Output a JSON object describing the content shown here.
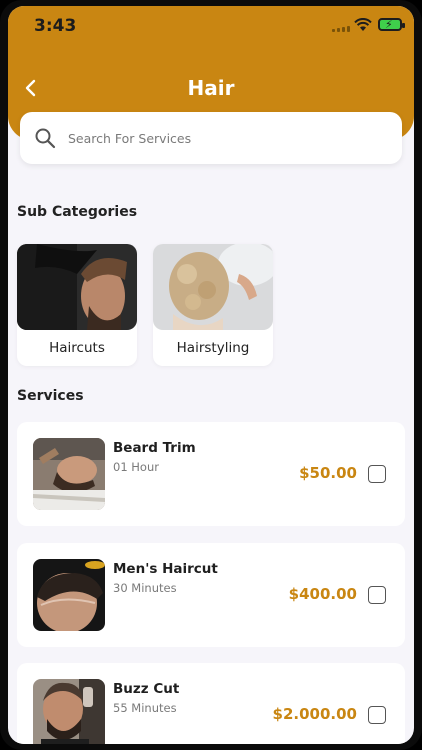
{
  "status_bar": {
    "time": "3:43"
  },
  "header": {
    "title": "Hair",
    "back_icon": "chevron-left-icon"
  },
  "search": {
    "placeholder": "Search For Services",
    "value": ""
  },
  "sub_categories": {
    "heading": "Sub Categories",
    "items": [
      {
        "label": "Haircuts"
      },
      {
        "label": "Hairstyling"
      }
    ]
  },
  "services": {
    "heading": "Services",
    "items": [
      {
        "name": "Beard Trim",
        "duration": "01 Hour",
        "price": "$50.00",
        "selected": false
      },
      {
        "name": "Men's Haircut",
        "duration": "30 Minutes",
        "price": "$400.00",
        "selected": false
      },
      {
        "name": "Buzz Cut",
        "duration": "55 Minutes",
        "price": "$2.000.00",
        "selected": false
      }
    ]
  },
  "colors": {
    "accent": "#c98612",
    "background": "#f6f5fa"
  }
}
